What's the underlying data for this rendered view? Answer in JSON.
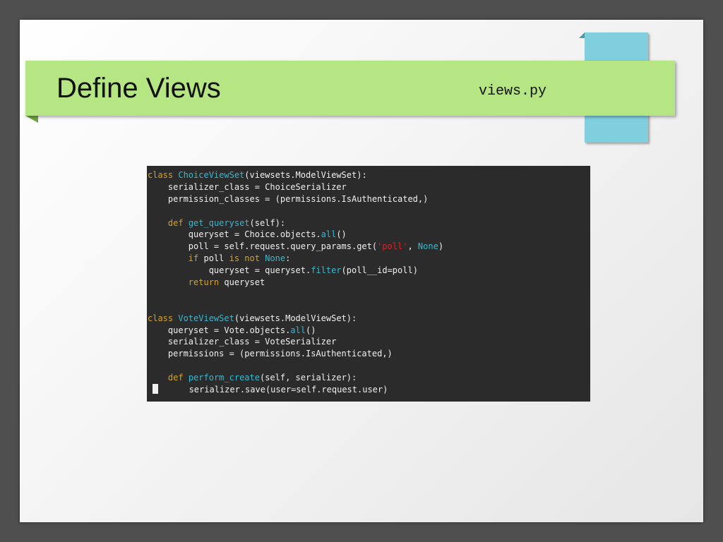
{
  "slide": {
    "title": "Define Views",
    "filename": "views.py"
  },
  "code": {
    "lines": [
      [
        {
          "t": "class",
          "c": "kw"
        },
        {
          "t": " "
        },
        {
          "t": "ChoiceViewSet",
          "c": "cls"
        },
        {
          "t": "(viewsets.ModelViewSet):"
        }
      ],
      [
        {
          "t": "    serializer_class = ChoiceSerializer"
        }
      ],
      [
        {
          "t": "    permission_classes = (permissions.IsAuthenticated,)"
        }
      ],
      [],
      [
        {
          "t": "    "
        },
        {
          "t": "def",
          "c": "kw"
        },
        {
          "t": " "
        },
        {
          "t": "get_queryset",
          "c": "fn"
        },
        {
          "t": "(self):"
        }
      ],
      [
        {
          "t": "        queryset = Choice.objects."
        },
        {
          "t": "all",
          "c": "bi"
        },
        {
          "t": "()"
        }
      ],
      [
        {
          "t": "        poll = self.request.query_params.get("
        },
        {
          "t": "'poll'",
          "c": "str"
        },
        {
          "t": ", "
        },
        {
          "t": "None",
          "c": "bi"
        },
        {
          "t": ")"
        }
      ],
      [
        {
          "t": "        "
        },
        {
          "t": "if",
          "c": "kw"
        },
        {
          "t": " poll "
        },
        {
          "t": "is not",
          "c": "kw"
        },
        {
          "t": " "
        },
        {
          "t": "None",
          "c": "bi"
        },
        {
          "t": ":"
        }
      ],
      [
        {
          "t": "            queryset = queryset."
        },
        {
          "t": "filter",
          "c": "bi"
        },
        {
          "t": "(poll__id=poll)"
        }
      ],
      [
        {
          "t": "        "
        },
        {
          "t": "return",
          "c": "kw"
        },
        {
          "t": " queryset"
        }
      ],
      [],
      [],
      [
        {
          "t": "class",
          "c": "kw"
        },
        {
          "t": " "
        },
        {
          "t": "VoteViewSet",
          "c": "cls"
        },
        {
          "t": "(viewsets.ModelViewSet):"
        }
      ],
      [
        {
          "t": "    queryset = Vote.objects."
        },
        {
          "t": "all",
          "c": "bi"
        },
        {
          "t": "()"
        }
      ],
      [
        {
          "t": "    serializer_class = VoteSerializer"
        }
      ],
      [
        {
          "t": "    permissions = (permissions.IsAuthenticated,)"
        }
      ],
      [],
      [
        {
          "t": "    "
        },
        {
          "t": "def",
          "c": "kw"
        },
        {
          "t": " "
        },
        {
          "t": "perform_create",
          "c": "fn"
        },
        {
          "t": "(self, serializer):"
        }
      ],
      [
        {
          "t": "    ",
          "cursor": true
        },
        {
          "t": "    serializer.save(user=self.request.user)"
        }
      ]
    ]
  }
}
